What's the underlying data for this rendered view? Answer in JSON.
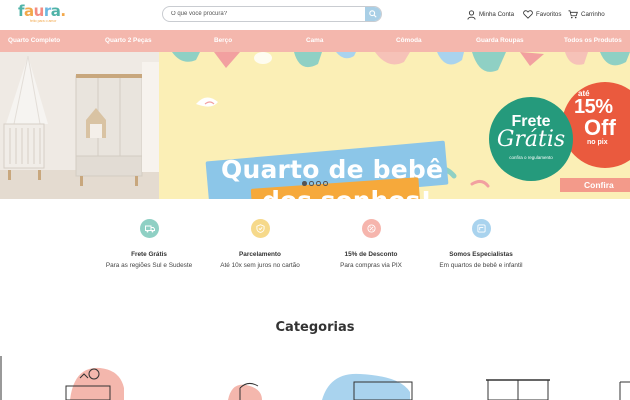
{
  "header": {
    "logo_text": "faura",
    "logo_tagline": "feito para o amor",
    "search_placeholder": "O que você procura?",
    "account_label": "Minha Conta",
    "favorites_label": "Favoritos",
    "cart_label": "Carrinho"
  },
  "nav": {
    "items": [
      {
        "label": "Quarto Completo"
      },
      {
        "label": "Quarto 2 Peças"
      },
      {
        "label": "Berço"
      },
      {
        "label": "Cama"
      },
      {
        "label": "Cômoda"
      },
      {
        "label": "Guarda Roupas"
      },
      {
        "label": "Todos os Produtos"
      }
    ]
  },
  "banner": {
    "headline_line1": "Quarto de bebê",
    "headline_line2": "dos sonhos!",
    "frete_line1": "Frete",
    "frete_line2": "Grátis",
    "frete_note": "confira o regulamento",
    "off_prefix": "até",
    "off_percent": "15%",
    "off_word": "Off",
    "off_suffix": "no pix",
    "cta_label": "Confira",
    "slide_count": 4,
    "active_slide": 0
  },
  "features": [
    {
      "icon": "truck-icon",
      "title": "Frete Grátis",
      "subtitle": "Para as regiões Sul e Sudeste",
      "color": "#8fd0c4"
    },
    {
      "icon": "installment-icon",
      "title": "Parcelamento",
      "subtitle": "Até 10x sem juros no cartão",
      "color": "#f6d98a"
    },
    {
      "icon": "discount-icon",
      "title": "15% de Desconto",
      "subtitle": "Para compras via PIX",
      "color": "#f6b5ad"
    },
    {
      "icon": "specialist-icon",
      "title": "Somos Especialistas",
      "subtitle": "Em quartos de bebê e infantil",
      "color": "#a9d3ee"
    }
  ],
  "categories": {
    "title": "Categorias"
  },
  "colors": {
    "nav_bg": "#f4b7ad",
    "banner_bg": "#fbefb6",
    "brand_teal": "#4fb3a8",
    "frete_green": "#259a7c",
    "off_red": "#ea5a3e"
  }
}
